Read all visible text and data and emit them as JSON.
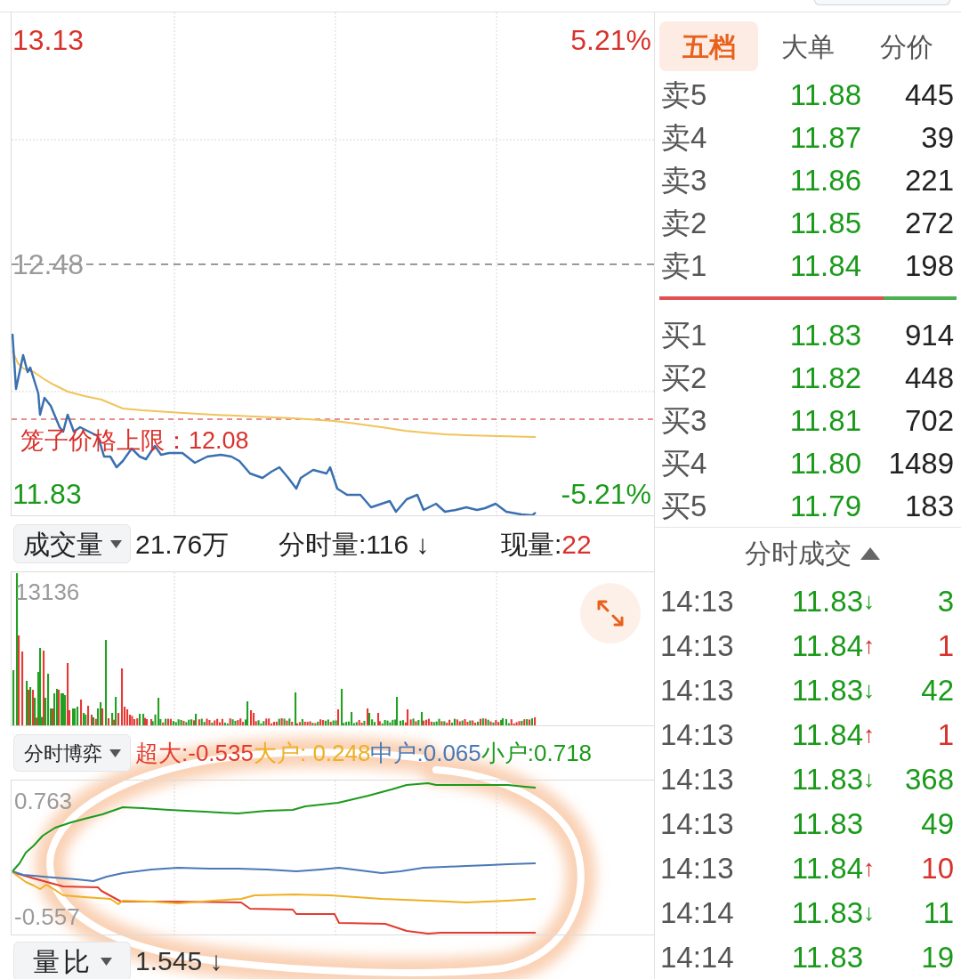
{
  "price_chart": {
    "high_price": "13.13",
    "high_change": "5.21%",
    "prev_close": "12.48",
    "cage_limit": "笼子价格上限：12.08",
    "low_price": "11.83",
    "low_change": "-5.21%"
  },
  "volume_header": {
    "selector": "成交量",
    "total": "21.76万",
    "minute_volume": "分时量:116 ↓",
    "current_label": "现量:",
    "current_value": "22"
  },
  "volume_chart": {
    "max_label": "13136"
  },
  "flow_header": {
    "selector": "分时博弈",
    "legend": [
      {
        "label": "超大:-0.535",
        "color": "#e23b2e"
      },
      {
        "label": "大户: 0.248",
        "color": "#eeb023"
      },
      {
        "label": "中户:0.065",
        "color": "#4a78b5"
      },
      {
        "label": "小户:0.718",
        "color": "#1c9a1c"
      }
    ]
  },
  "flow_chart": {
    "max_label": "0.763",
    "min_label": "-0.557"
  },
  "ratio_row": {
    "selector": "量比",
    "value": "1.545 ↓"
  },
  "side_tabs": [
    {
      "label": "五档",
      "selected": true
    },
    {
      "label": "大单",
      "selected": false
    },
    {
      "label": "分价",
      "selected": false
    }
  ],
  "order_book": {
    "asks": [
      {
        "label": "卖5",
        "price": "11.88",
        "volume": "445"
      },
      {
        "label": "卖4",
        "price": "11.87",
        "volume": "39"
      },
      {
        "label": "卖3",
        "price": "11.86",
        "volume": "221"
      },
      {
        "label": "卖2",
        "price": "11.85",
        "volume": "272"
      },
      {
        "label": "卖1",
        "price": "11.84",
        "volume": "198"
      }
    ],
    "bid_ratio": {
      "level": 0.755
    },
    "bids": [
      {
        "label": "买1",
        "price": "11.83",
        "volume": "914"
      },
      {
        "label": "买2",
        "price": "11.82",
        "volume": "448"
      },
      {
        "label": "买3",
        "price": "11.81",
        "volume": "702"
      },
      {
        "label": "买4",
        "price": "11.80",
        "volume": "1489"
      },
      {
        "label": "买5",
        "price": "11.79",
        "volume": "183"
      }
    ]
  },
  "trades": {
    "title": "分时成交",
    "items": [
      {
        "kind": "down",
        "time": "14:13",
        "price": "11.83",
        "arrow": "↓",
        "volume": "3"
      },
      {
        "kind": "up",
        "time": "14:13",
        "price": "11.84",
        "arrow": "↑",
        "volume": "1"
      },
      {
        "kind": "down",
        "time": "14:13",
        "price": "11.83",
        "arrow": "↓",
        "volume": "42"
      },
      {
        "kind": "up",
        "time": "14:13",
        "price": "11.84",
        "arrow": "↑",
        "volume": "1"
      },
      {
        "kind": "down",
        "time": "14:13",
        "price": "11.83",
        "arrow": "↓",
        "volume": "368"
      },
      {
        "kind": "flat",
        "time": "14:13",
        "price": "11.83",
        "volume": "49"
      },
      {
        "kind": "up",
        "time": "14:13",
        "price": "11.84",
        "arrow": "↑",
        "volume": "10"
      },
      {
        "kind": "down",
        "time": "14:14",
        "price": "11.83",
        "arrow": "↓",
        "volume": "11"
      },
      {
        "kind": "flat",
        "time": "14:14",
        "price": "11.83",
        "volume": "19"
      }
    ]
  }
}
